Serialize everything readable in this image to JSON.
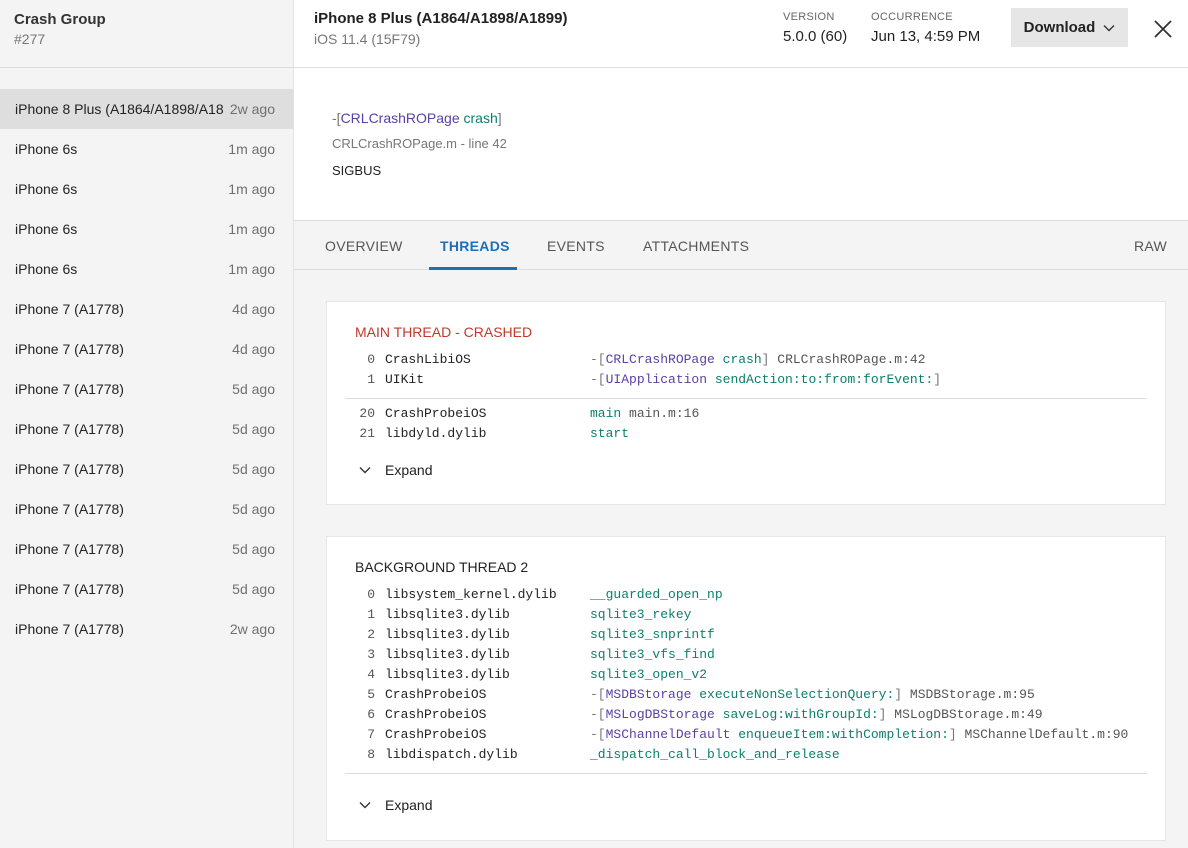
{
  "sidebar": {
    "title": "Crash Group",
    "subtitle": "#277",
    "items": [
      {
        "name": "iPhone 8 Plus (A1864/A1898/A18",
        "time": "2w ago"
      },
      {
        "name": "iPhone 6s",
        "time": "1m ago"
      },
      {
        "name": "iPhone 6s",
        "time": "1m ago"
      },
      {
        "name": "iPhone 6s",
        "time": "1m ago"
      },
      {
        "name": "iPhone 6s",
        "time": "1m ago"
      },
      {
        "name": "iPhone 7 (A1778)",
        "time": "4d ago"
      },
      {
        "name": "iPhone 7 (A1778)",
        "time": "4d ago"
      },
      {
        "name": "iPhone 7 (A1778)",
        "time": "5d ago"
      },
      {
        "name": "iPhone 7 (A1778)",
        "time": "5d ago"
      },
      {
        "name": "iPhone 7 (A1778)",
        "time": "5d ago"
      },
      {
        "name": "iPhone 7 (A1778)",
        "time": "5d ago"
      },
      {
        "name": "iPhone 7 (A1778)",
        "time": "5d ago"
      },
      {
        "name": "iPhone 7 (A1778)",
        "time": "5d ago"
      },
      {
        "name": "iPhone 7 (A1778)",
        "time": "2w ago"
      }
    ]
  },
  "header": {
    "title": "iPhone 8 Plus (A1864/A1898/A1899)",
    "subtitle": "iOS 11.4 (15F79)",
    "version_label": "VERSION",
    "version_value": "5.0.0 (60)",
    "occurrence_label": "OCCURRENCE",
    "occurrence_value": "Jun 13, 4:59 PM",
    "download_label": "Download"
  },
  "summary": {
    "frame_prefix": "-[",
    "frame_class": "CRLCrashROPage",
    "frame_method": "crash",
    "frame_suffix": "]",
    "file": "CRLCrashROPage.m - line 42",
    "signal": "SIGBUS"
  },
  "tabs": {
    "overview": "OVERVIEW",
    "threads": "THREADS",
    "events": "EVENTS",
    "attachments": "ATTACHMENTS",
    "raw": "RAW"
  },
  "threads": [
    {
      "title": "MAIN THREAD - CRASHED",
      "expand_label": "Expand",
      "frames_top": [
        {
          "num": "0",
          "lib": "CrashLibiOS",
          "pre": "-[",
          "cls": "CRLCrashROPage",
          "mth": "crash",
          "post": "]",
          "file": "CRLCrashROPage.m:42"
        },
        {
          "num": "1",
          "lib": "UIKit",
          "pre": "-[",
          "cls": "UIApplication",
          "mth": "sendAction:to:from:forEvent:",
          "post": "]",
          "file": ""
        }
      ],
      "frames_bottom": [
        {
          "num": "20",
          "lib": "CrashProbeiOS",
          "pre": "",
          "cls": "",
          "mth": "main",
          "post": "",
          "file": "main.m:16"
        },
        {
          "num": "21",
          "lib": "libdyld.dylib",
          "pre": "",
          "cls": "",
          "mth": "start",
          "post": "",
          "file": ""
        }
      ]
    },
    {
      "title": "BACKGROUND THREAD 2",
      "expand_label": "Expand",
      "frames_top": [
        {
          "num": "0",
          "lib": "libsystem_kernel.dylib",
          "pre": "",
          "cls": "",
          "mth": "__guarded_open_np",
          "post": "",
          "file": ""
        },
        {
          "num": "1",
          "lib": "libsqlite3.dylib",
          "pre": "",
          "cls": "",
          "mth": "sqlite3_rekey",
          "post": "",
          "file": ""
        },
        {
          "num": "2",
          "lib": "libsqlite3.dylib",
          "pre": "",
          "cls": "",
          "mth": "sqlite3_snprintf",
          "post": "",
          "file": ""
        },
        {
          "num": "3",
          "lib": "libsqlite3.dylib",
          "pre": "",
          "cls": "",
          "mth": "sqlite3_vfs_find",
          "post": "",
          "file": ""
        },
        {
          "num": "4",
          "lib": "libsqlite3.dylib",
          "pre": "",
          "cls": "",
          "mth": "sqlite3_open_v2",
          "post": "",
          "file": ""
        },
        {
          "num": "5",
          "lib": "CrashProbeiOS",
          "pre": "-[",
          "cls": "MSDBStorage",
          "mth": "executeNonSelectionQuery:",
          "post": "]",
          "file": "MSDBStorage.m:95"
        },
        {
          "num": "6",
          "lib": "CrashProbeiOS",
          "pre": "-[",
          "cls": "MSLogDBStorage",
          "mth": "saveLog:withGroupId:",
          "post": "]",
          "file": "MSLogDBStorage.m:49"
        },
        {
          "num": "7",
          "lib": "CrashProbeiOS",
          "pre": "-[",
          "cls": "MSChannelDefault",
          "mth": "enqueueItem:withCompletion:",
          "post": "]",
          "file": "MSChannelDefault.m:90"
        },
        {
          "num": "8",
          "lib": "libdispatch.dylib",
          "pre": "",
          "cls": "",
          "mth": "_dispatch_call_block_and_release",
          "post": "",
          "file": ""
        }
      ],
      "frames_bottom": []
    }
  ],
  "icons": {
    "download": "chevron-down-icon",
    "close": "close-icon",
    "expand": "chevron-down-icon"
  },
  "colors": {
    "accent": "#1e6fb5",
    "crashed": "#c0392b",
    "class": "#5b3fa6",
    "method": "#0b7f6b"
  }
}
